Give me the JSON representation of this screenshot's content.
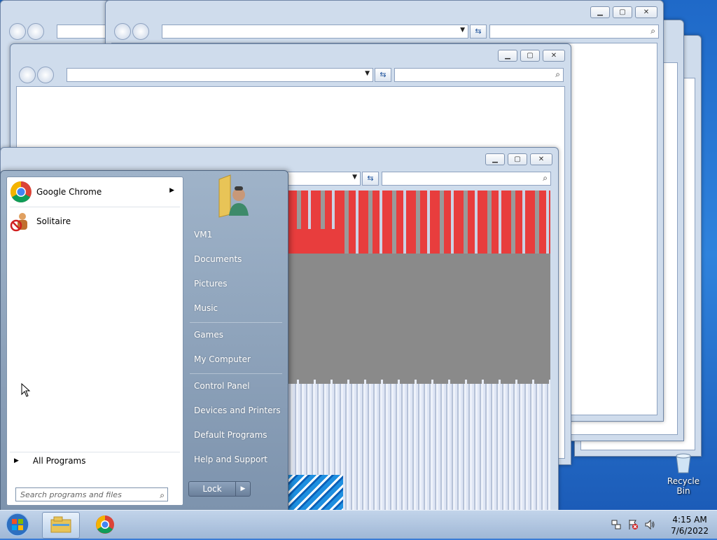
{
  "start_menu": {
    "pinned": [
      {
        "label": "Google Chrome",
        "icon": "chrome-icon",
        "has_submenu": true
      },
      {
        "label": "Solitaire",
        "icon": "solitaire-icon",
        "has_submenu": false
      }
    ],
    "all_programs": "All Programs",
    "search_placeholder": "Search programs and files",
    "user_icon": "user-folder-icon",
    "right_items": [
      "VM1",
      "Documents",
      "Pictures",
      "Music",
      "Games",
      "My Computer",
      "Control Panel",
      "Devices and Printers",
      "Default Programs",
      "Help and Support"
    ],
    "lock_label": "Lock"
  },
  "desktop": {
    "recycle_bin_label": "Recycle Bin"
  },
  "taskbar": {
    "time": "4:15 AM",
    "date": "7/6/2022",
    "pinned": [
      "windows-explorer-icon",
      "chrome-icon"
    ]
  },
  "colors": {
    "glitch_red": "#e83d3d",
    "glitch_gray": "#8a8a8a",
    "start_menu_panel": "#8fa5bf"
  }
}
